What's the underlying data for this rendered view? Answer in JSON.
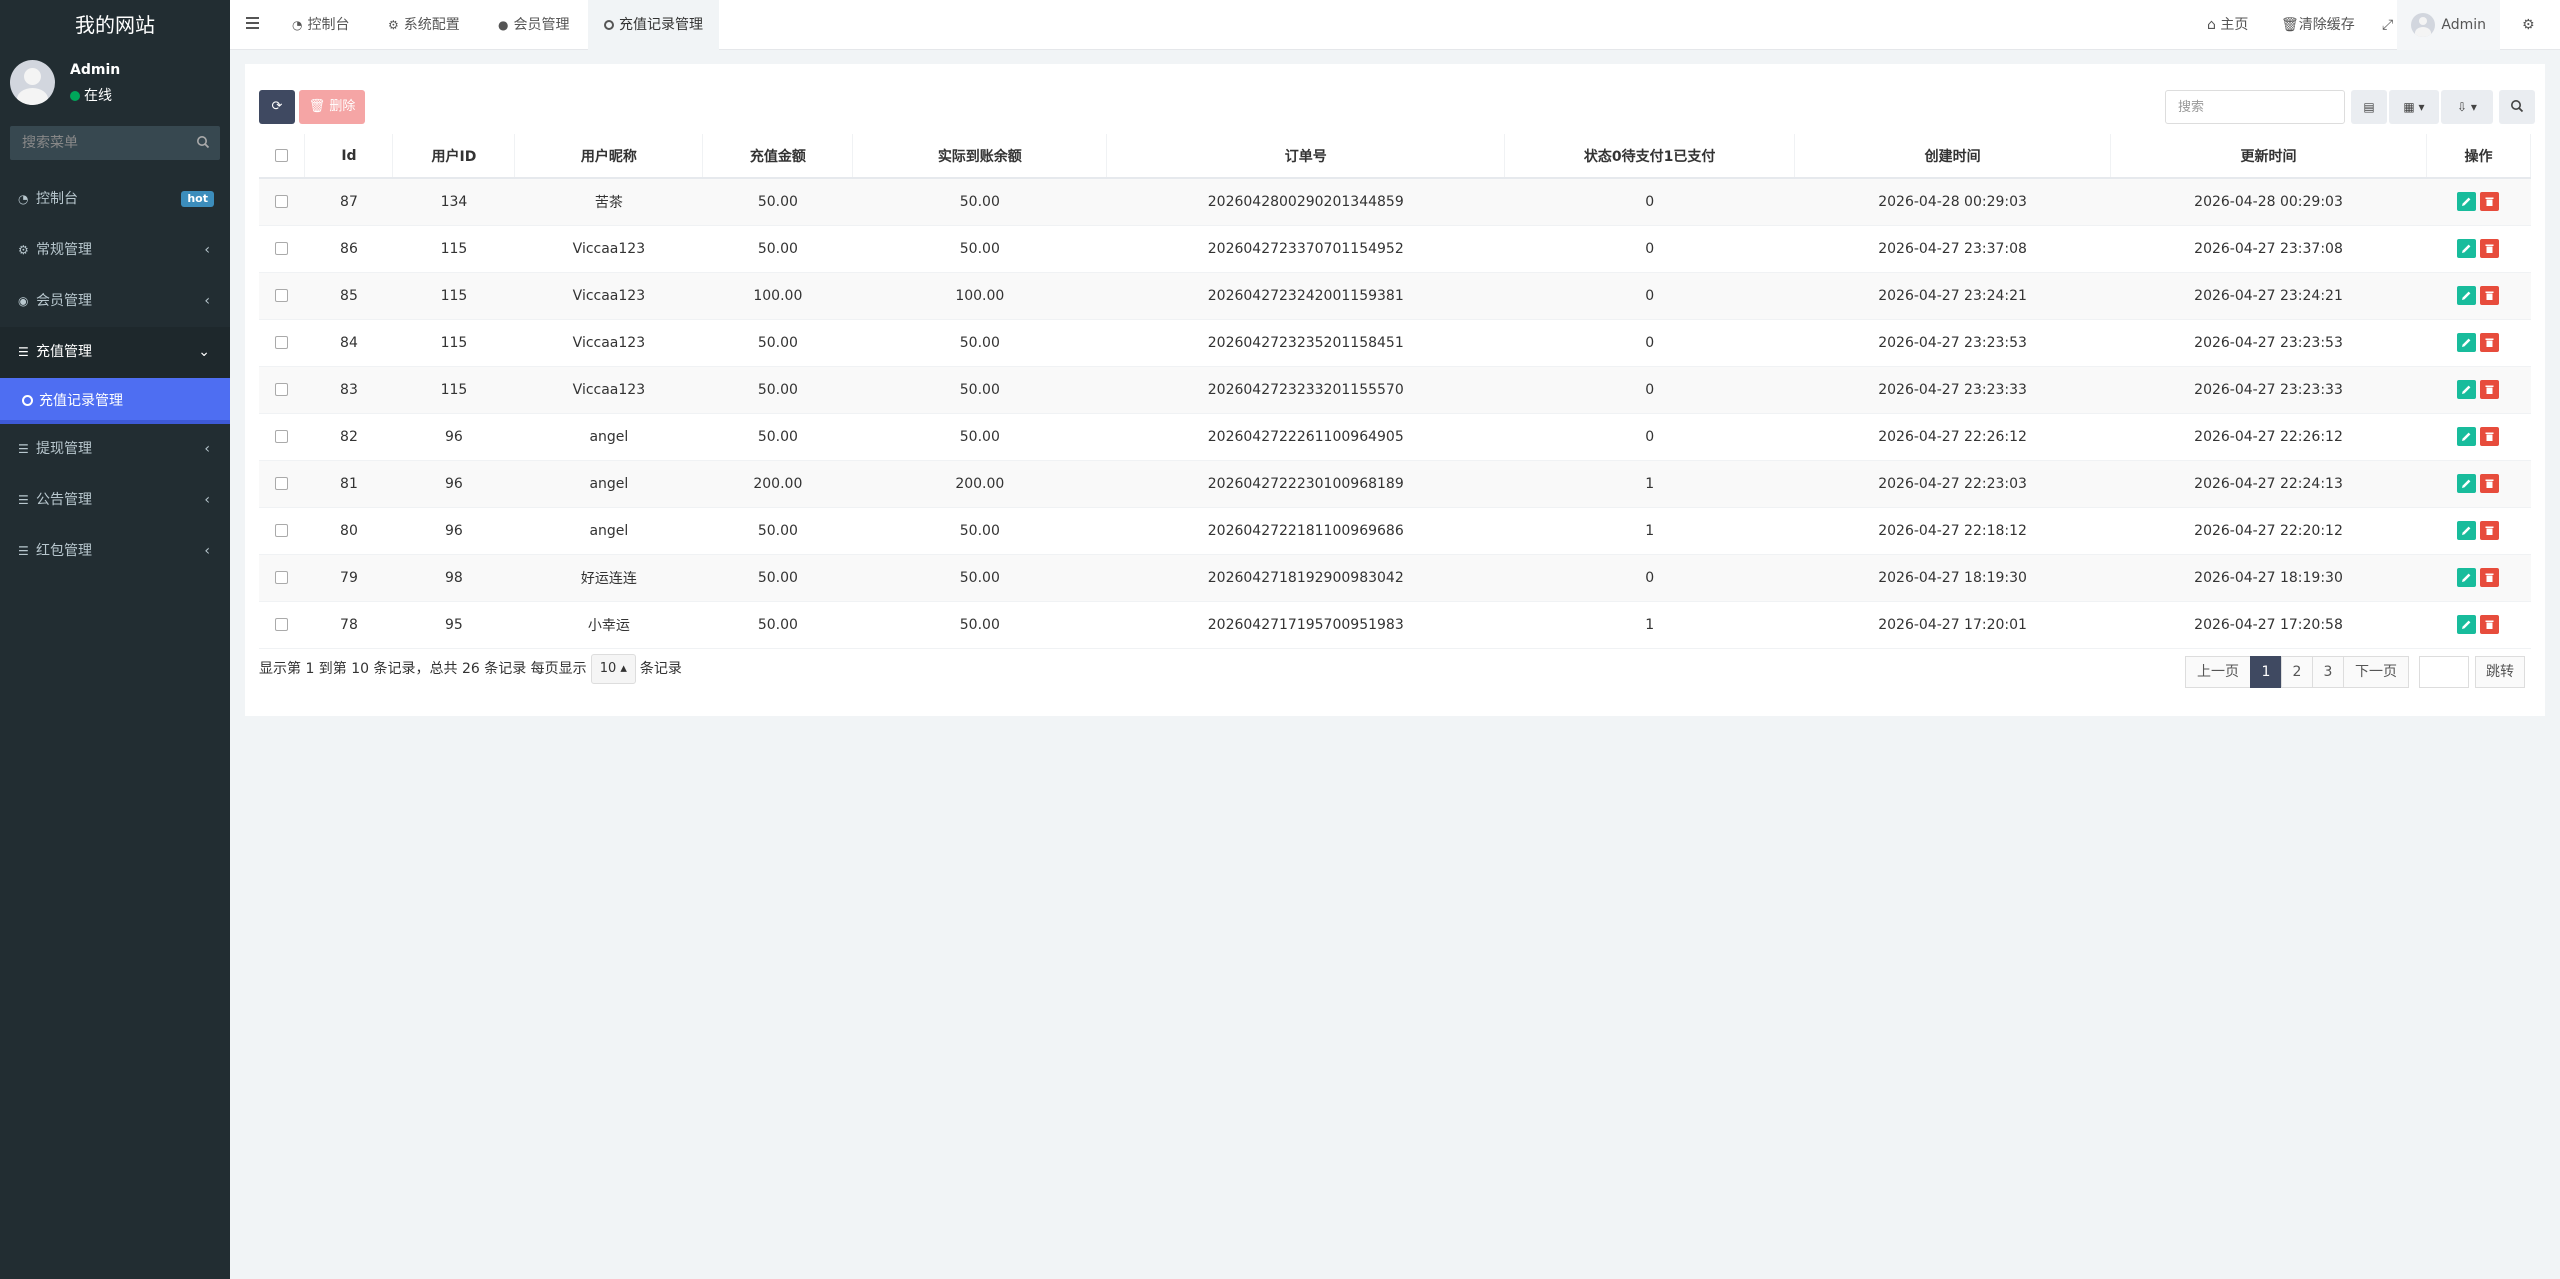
{
  "brand": "我的网站",
  "user": {
    "name": "Admin",
    "status": "在线"
  },
  "sidebar": {
    "search_placeholder": "搜索菜单",
    "items": [
      {
        "label": "控制台",
        "badge": "hot"
      },
      {
        "label": "常规管理"
      },
      {
        "label": "会员管理"
      },
      {
        "label": "充值管理"
      },
      {
        "label": "提现管理"
      },
      {
        "label": "公告管理"
      },
      {
        "label": "红包管理"
      }
    ],
    "sub_item": "充值记录管理"
  },
  "header": {
    "tabs": [
      "控制台",
      "系统配置",
      "会员管理",
      "充值记录管理"
    ],
    "home": "主页",
    "clear_cache": "清除缓存",
    "user": "Admin"
  },
  "toolbar": {
    "delete_label": "删除",
    "search_placeholder": "搜索"
  },
  "table": {
    "columns": [
      "Id",
      "用户ID",
      "用户昵称",
      "充值金额",
      "实际到账余额",
      "订单号",
      "状态0待支付1已支付",
      "创建时间",
      "更新时间",
      "操作"
    ],
    "rows": [
      [
        "87",
        "134",
        "苦茶",
        "50.00",
        "50.00",
        "20260428002902013448​59",
        "0",
        "2026-04-28 00:29:03",
        "2026-04-28 00:29:03"
      ],
      [
        "86",
        "115",
        "Viccaa123",
        "50.00",
        "50.00",
        "202604272337070115495​2",
        "0",
        "2026-04-27 23:37:08",
        "2026-04-27 23:37:08"
      ],
      [
        "85",
        "115",
        "Viccaa123",
        "100.00",
        "100.00",
        "202604272324200115938​1",
        "0",
        "2026-04-27 23:24:21",
        "2026-04-27 23:24:21"
      ],
      [
        "84",
        "115",
        "Viccaa123",
        "50.00",
        "50.00",
        "202604272323520115845​1",
        "0",
        "2026-04-27 23:23:53",
        "2026-04-27 23:23:53"
      ],
      [
        "83",
        "115",
        "Viccaa123",
        "50.00",
        "50.00",
        "202604272323320115557​0",
        "0",
        "2026-04-27 23:23:33",
        "2026-04-27 23:23:33"
      ],
      [
        "82",
        "96",
        "angel",
        "50.00",
        "50.00",
        "202604272226110096490​5",
        "0",
        "2026-04-27 22:26:12",
        "2026-04-27 22:26:12"
      ],
      [
        "81",
        "96",
        "angel",
        "200.00",
        "200.00",
        "202604272223010096818​9",
        "1",
        "2026-04-27 22:23:03",
        "2026-04-27 22:24:13"
      ],
      [
        "80",
        "96",
        "angel",
        "50.00",
        "50.00",
        "202604272218110096968​6",
        "1",
        "2026-04-27 22:18:12",
        "2026-04-27 22:20:12"
      ],
      [
        "79",
        "98",
        "好运连连",
        "50.00",
        "50.00",
        "202604271819290098304​2",
        "0",
        "2026-04-27 18:19:30",
        "2026-04-27 18:19:30"
      ],
      [
        "78",
        "95",
        "小幸运",
        "50.00",
        "50.00",
        "202604271719570095198​3",
        "1",
        "2026-04-27 17:20:01",
        "2026-04-27 17:20:58"
      ]
    ]
  },
  "footer": {
    "info_prefix": "显示第 1 到第 10 条记录，总共 26 条记录 每页显示",
    "page_size": "10",
    "info_suffix": "条记录"
  },
  "pagination": {
    "prev": "上一页",
    "pages": [
      "1",
      "2",
      "3"
    ],
    "next": "下一页",
    "jump": "跳转"
  }
}
